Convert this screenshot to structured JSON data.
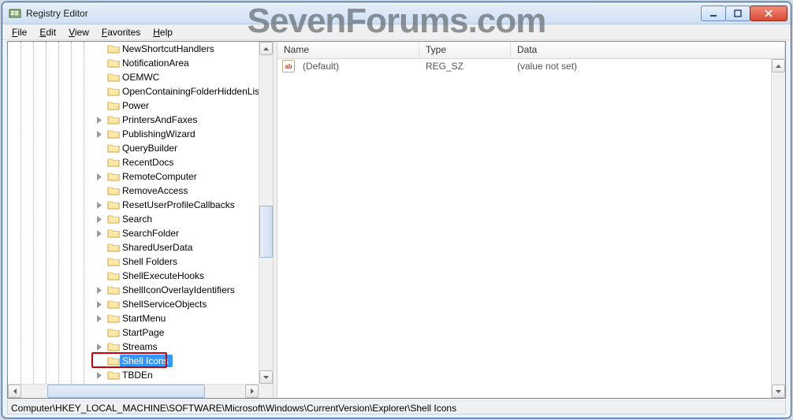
{
  "window": {
    "title": "Registry Editor"
  },
  "menu": {
    "file": "File",
    "edit": "Edit",
    "view": "View",
    "favorites": "Favorites",
    "help": "Help"
  },
  "watermark": "SevenForums.com",
  "tree": {
    "items": [
      {
        "label": "NewShortcutHandlers",
        "exp": false
      },
      {
        "label": "NotificationArea",
        "exp": false
      },
      {
        "label": "OEMWC",
        "exp": false
      },
      {
        "label": "OpenContainingFolderHiddenList",
        "exp": false
      },
      {
        "label": "Power",
        "exp": false
      },
      {
        "label": "PrintersAndFaxes",
        "exp": true
      },
      {
        "label": "PublishingWizard",
        "exp": true
      },
      {
        "label": "QueryBuilder",
        "exp": false
      },
      {
        "label": "RecentDocs",
        "exp": false
      },
      {
        "label": "RemoteComputer",
        "exp": true
      },
      {
        "label": "RemoveAccess",
        "exp": false
      },
      {
        "label": "ResetUserProfileCallbacks",
        "exp": true
      },
      {
        "label": "Search",
        "exp": true
      },
      {
        "label": "SearchFolder",
        "exp": true
      },
      {
        "label": "SharedUserData",
        "exp": false
      },
      {
        "label": "Shell Folders",
        "exp": false
      },
      {
        "label": "ShellExecuteHooks",
        "exp": false
      },
      {
        "label": "ShellIconOverlayIdentifiers",
        "exp": true
      },
      {
        "label": "ShellServiceObjects",
        "exp": true
      },
      {
        "label": "StartMenu",
        "exp": true
      },
      {
        "label": "StartPage",
        "exp": false
      },
      {
        "label": "Streams",
        "exp": true
      },
      {
        "label": "Shell Icons",
        "exp": false,
        "selected": true,
        "highlighted_red": true
      },
      {
        "label": "TBDEn",
        "exp": true
      }
    ]
  },
  "list": {
    "columns": {
      "name": "Name",
      "type": "Type",
      "data": "Data"
    },
    "rows": [
      {
        "name": "(Default)",
        "type": "REG_SZ",
        "data": "(value not set)"
      }
    ]
  },
  "statusbar": "Computer\\HKEY_LOCAL_MACHINE\\SOFTWARE\\Microsoft\\Windows\\CurrentVersion\\Explorer\\Shell Icons"
}
